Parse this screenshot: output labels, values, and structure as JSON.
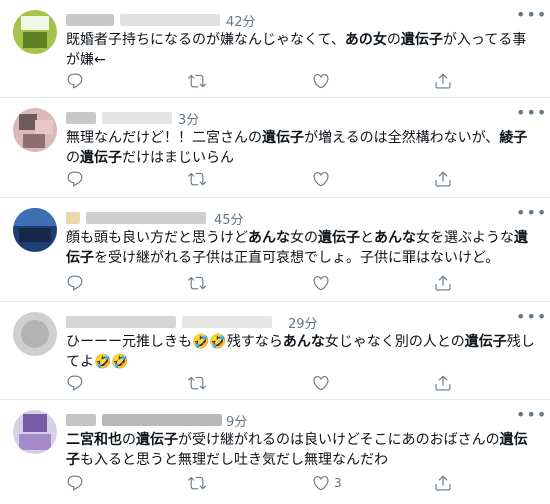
{
  "tweets": [
    {
      "time": "42分",
      "text": "既婚者子持ちになるのが嫌なんじゃなくて、<b>あの女</b>の<b>遺伝子</b>が入ってる事が嫌←",
      "like_count": ""
    },
    {
      "time": "3分",
      "text": "無理なんだけど！！二宮さんの<b>遺伝子</b>が増えるのは全然構わないが、<b>綾子</b>の<b>遺伝子</b>だけはまじいらん",
      "like_count": ""
    },
    {
      "time": "45分",
      "text": "顔も頭も良い方だと思うけど<b>あんな</b>女の<b>遺伝子</b>と<b>あんな</b>女を選ぶような<b>遺伝子</b>を受け継がれる子供は正直可哀想でしょ。子供に罪はないけど。",
      "like_count": ""
    },
    {
      "time": "29分",
      "text": "ひーーー元推しきも🤣🤣残すなら<b>あんな</b>女じゃなく別の人との<b>遺伝子</b>残してよ🤣🤣",
      "like_count": ""
    },
    {
      "time": "9分",
      "text": "<b>二宮和也</b>の<b>遺伝子</b>が受け継がれるのは良いけどそこにあのおばさんの<b>遺伝子</b>も入ると思うと無理だし吐き気だし無理なんだわ",
      "like_count": "3"
    }
  ],
  "icons": [
    "reply-icon",
    "retweet-icon",
    "like-icon",
    "share-icon",
    "more-icon"
  ],
  "colors": {
    "secondary": "#657786",
    "divider": "#e1e8ed",
    "text": "#0f1419"
  }
}
